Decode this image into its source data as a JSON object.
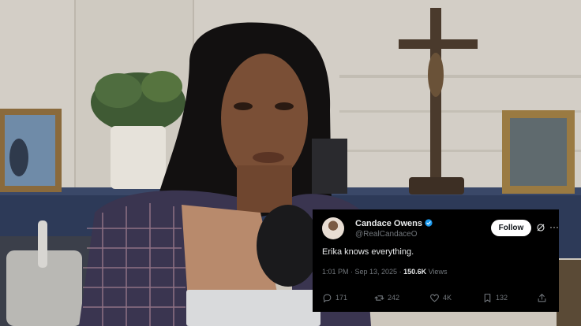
{
  "tweet": {
    "display_name": "Candace Owens",
    "handle": "@RealCandaceO",
    "follow_label": "Follow",
    "text": "Erika knows everything.",
    "timestamp": "1:01 PM · Sep 13, 2025 · ",
    "views_count": "150.6K",
    "views_label": " Views",
    "replies": "171",
    "reposts": "242",
    "likes": "4K",
    "bookmarks": "132"
  },
  "colors": {
    "card_bg": "#000000",
    "text_primary": "#e7e9ea",
    "text_secondary": "#71767b",
    "verified_blue": "#1d9bf0",
    "follow_bg": "#ffffff"
  },
  "icons": [
    "verified-badge-icon",
    "grok-icon",
    "more-icon",
    "reply-icon",
    "repost-icon",
    "like-icon",
    "bookmark-icon",
    "share-icon"
  ]
}
